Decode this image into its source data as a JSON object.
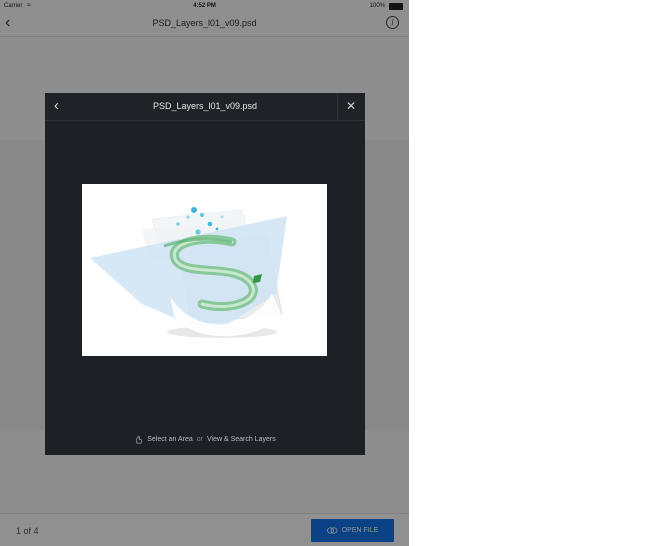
{
  "status_bar": {
    "carrier": "Carrier",
    "time": "4:52 PM",
    "battery": "100%"
  },
  "nav_bar": {
    "title": "PSD_Layers_l01_v09.psd",
    "back_icon": "chevron-left-icon",
    "info_icon": "info-icon"
  },
  "bottom_bar": {
    "page_count": "1 of 4",
    "open_file_label": "OPEN FILE"
  },
  "modal": {
    "title": "PSD_Layers_l01_v09.psd",
    "back_icon": "chevron-left-icon",
    "close_icon": "close-icon",
    "footer": {
      "select_area": "Select an Area",
      "or": "or",
      "view_search": "View & Search Layers"
    }
  },
  "colors": {
    "accent": "#1473e6",
    "modal_bg": "#1d2024"
  }
}
